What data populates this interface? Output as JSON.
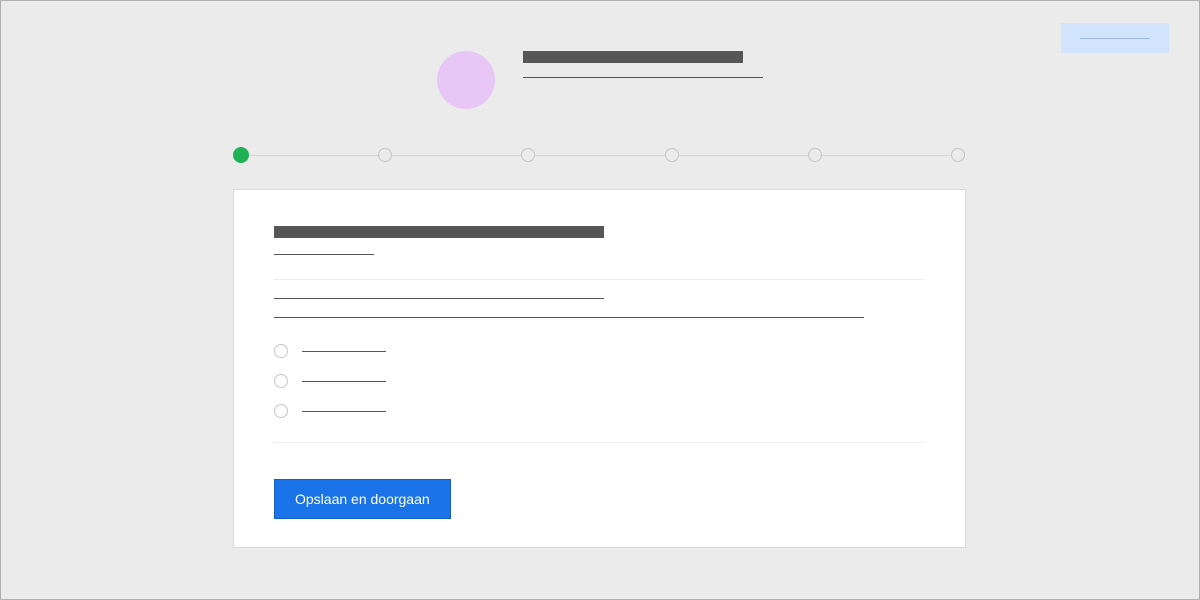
{
  "top_button_label": "",
  "header": {
    "title": "",
    "subtitle": ""
  },
  "stepper": {
    "steps": [
      {
        "state": "active"
      },
      {
        "state": "inactive"
      },
      {
        "state": "inactive"
      },
      {
        "state": "inactive"
      },
      {
        "state": "inactive"
      },
      {
        "state": "inactive"
      }
    ]
  },
  "card": {
    "section_title": "",
    "section_subtitle": "",
    "question_line": "",
    "detail_line": "",
    "options": [
      {
        "label": ""
      },
      {
        "label": ""
      },
      {
        "label": ""
      }
    ],
    "primary_button_label": "Opslaan en doorgaan"
  },
  "colors": {
    "accent_blue": "#1a73e8",
    "step_active_green": "#1fb254",
    "avatar_purple": "#e8c6f5",
    "top_button_bg": "#d2e3fc"
  }
}
